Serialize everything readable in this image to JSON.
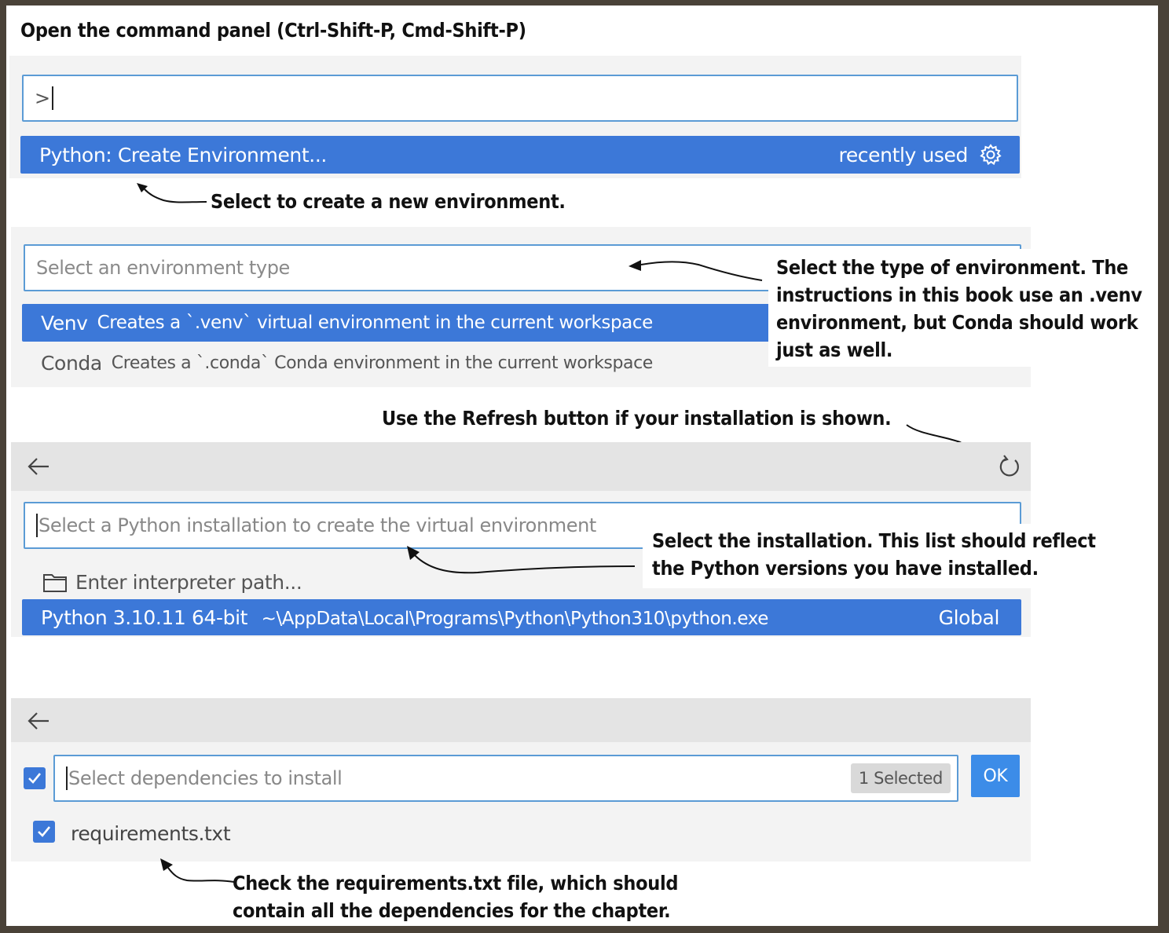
{
  "annotations": {
    "open_panel": "Open the command panel (Ctrl-Shift-P, Cmd-Shift-P)",
    "create_env": "Select to create a new environment.",
    "env_type": [
      "Select the type of environment. The",
      "instructions in this book use an .venv",
      "environment, but Conda should work",
      "just as well."
    ],
    "refresh": "Use the Refresh button if your installation is shown.",
    "installation": [
      "Select the installation. This list should reflect",
      "the Python versions you have installed."
    ],
    "requirements": [
      "Check the requirements.txt file, which should",
      "contain all the dependencies for the chapter."
    ]
  },
  "command_panel": {
    "input_value": ">",
    "item_label": "Python: Create Environment...",
    "item_hint": "recently used"
  },
  "env_type_panel": {
    "placeholder": "Select an environment type",
    "options": [
      {
        "name": "Venv",
        "description": "Creates a `.venv` virtual environment in the current workspace"
      },
      {
        "name": "Conda",
        "description": "Creates a `.conda` Conda environment in the current workspace"
      }
    ]
  },
  "installation_panel": {
    "placeholder": "Select a Python installation to create the virtual environment",
    "enter_path": "Enter interpreter path...",
    "python_version": "Python 3.10.11 64-bit",
    "python_path": "~\\AppData\\Local\\Programs\\Python\\Python310\\python.exe",
    "python_scope": "Global"
  },
  "deps_panel": {
    "placeholder": "Select dependencies to install",
    "selected_badge": "1 Selected",
    "ok_label": "OK",
    "file": "requirements.txt"
  },
  "colors": {
    "selection": "#3c78d8",
    "input_border": "#5b9bd5",
    "panel_bg": "#f3f3f3"
  }
}
